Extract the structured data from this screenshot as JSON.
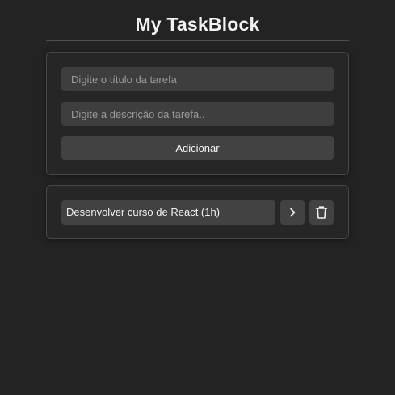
{
  "header": {
    "title": "My TaskBlock"
  },
  "form": {
    "title_placeholder": "Digite o título da tarefa",
    "description_placeholder": "Digite a descrição da tarefa..",
    "add_label": "Adicionar"
  },
  "tasks": [
    {
      "title": "Desenvolver curso de React (1h)",
      "details_icon": "chevron-right-icon",
      "delete_icon": "trash-icon"
    }
  ],
  "colors": {
    "background": "#232323",
    "card_background": "#262626",
    "input_background": "#3e3e3e",
    "button_background": "#424242",
    "text": "#ffffff"
  }
}
